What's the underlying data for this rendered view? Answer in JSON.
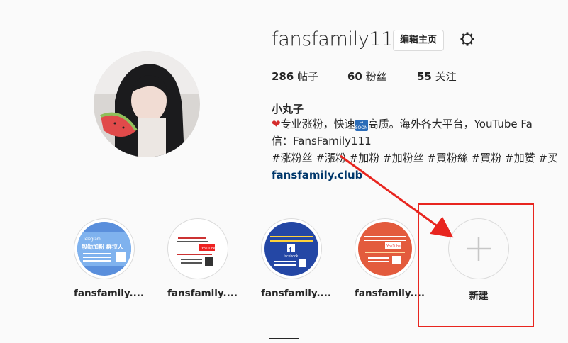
{
  "profile": {
    "username": "fansfamily111",
    "edit_button": "编辑主页",
    "stats": {
      "posts_count": "286",
      "posts_label": "帖子",
      "followers_count": "60",
      "followers_label": "粉丝",
      "following_count": "55",
      "following_label": "关注"
    },
    "full_name": "小丸子",
    "bio": {
      "line1_a": "专业涨粉，快速",
      "line1_b": "高质。海外各大平台，YouTube Fa",
      "soon_text": "SOON",
      "line2": "信：FansFamily111",
      "line3": "#涨粉丝 #漲粉 #加粉 #加粉丝 #買粉絲 #買粉 #加赞 #买"
    },
    "website": "fansfamily.club"
  },
  "highlights": [
    {
      "label": "fansfamily....",
      "thumb_title": "Telegram",
      "thumb_main": "殷勤加粉 群拉人",
      "color": "#4a7fd0"
    },
    {
      "label": "fansfamily....",
      "thumb_title": "YouTube",
      "thumb_main": "",
      "color": "#ffffff"
    },
    {
      "label": "fansfamily....",
      "thumb_title": "facebook",
      "thumb_main": "",
      "color": "#2a4ea8"
    },
    {
      "label": "fansfamily....",
      "thumb_title": "YouTube",
      "thumb_main": "",
      "color": "#e0583a"
    }
  ],
  "new_highlight": {
    "label": "新建"
  },
  "annotation": {
    "color": "#e8251f"
  },
  "icons": {
    "settings": "gear-icon",
    "new": "plus-icon",
    "heart": "heart-emoji",
    "soon": "soon-arrow-emoji"
  }
}
